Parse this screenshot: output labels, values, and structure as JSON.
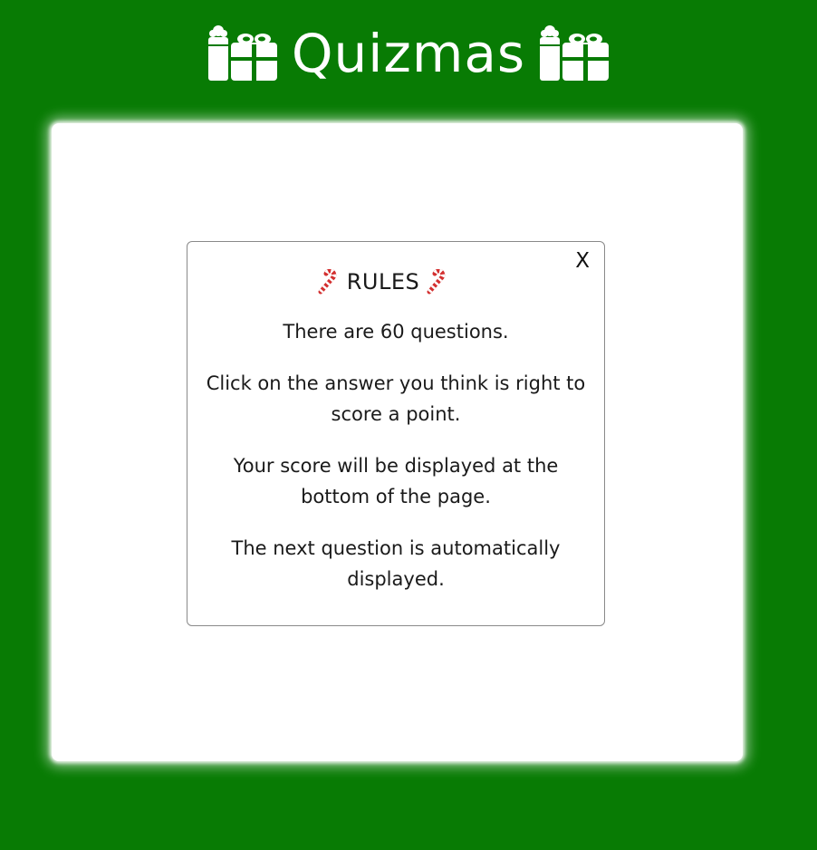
{
  "header": {
    "title": "Quizmas",
    "left_icon": "gift-icon",
    "right_icon": "gift-icon",
    "text_color": "#ffffff"
  },
  "colors": {
    "background": "#087b04",
    "card": "#ffffff",
    "modal_border": "#8a8a8a",
    "candy_red": "#d32f2f"
  },
  "modal": {
    "close_label": "X",
    "heading": "RULES",
    "heading_icon": "candy-cane-icon",
    "rules": [
      "There are 60 questions.",
      "Click on the answer you think is right to score a point.",
      "Your score will be displayed at the bottom of the page.",
      "The next question is automatically displayed."
    ]
  }
}
